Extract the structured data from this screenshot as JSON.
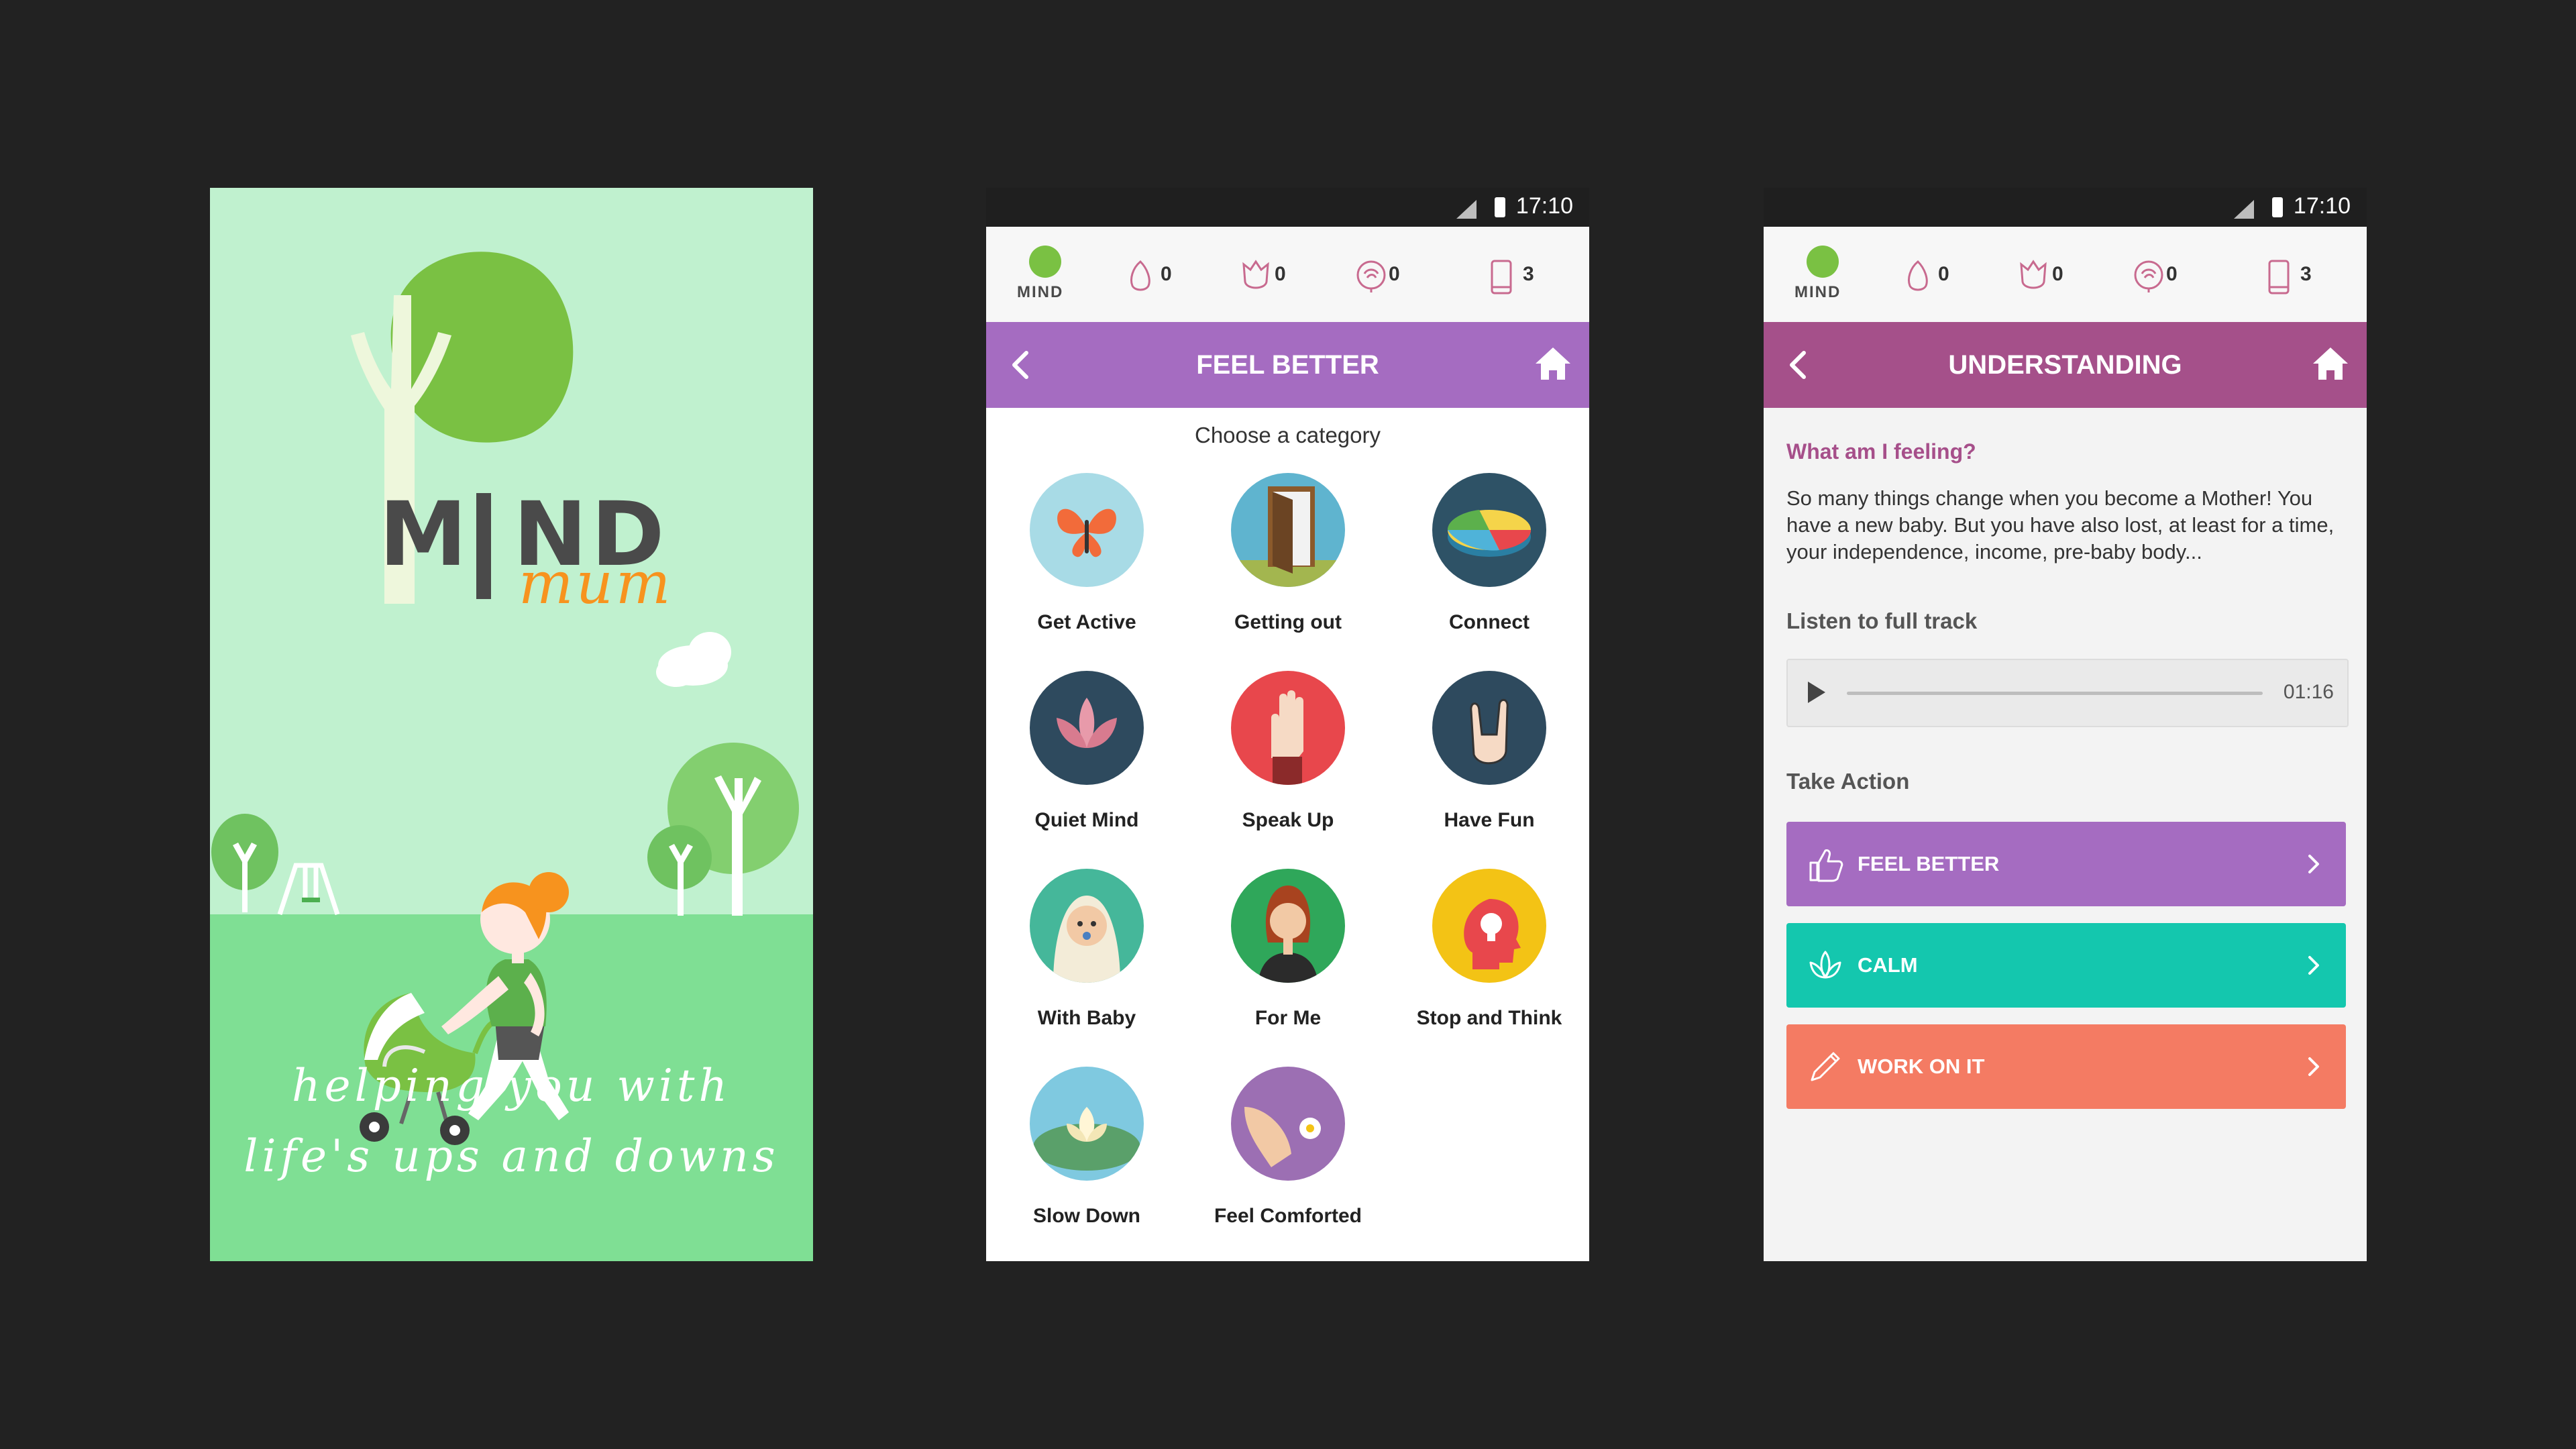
{
  "splash": {
    "logo_letters": [
      "M",
      "N",
      "D"
    ],
    "logo_sub": "mum",
    "tagline_line1": "helping you with",
    "tagline_line2": "life's ups and downs"
  },
  "status": {
    "time": "17:10"
  },
  "appbar": {
    "logo_text": "MIND",
    "counters": [
      {
        "icon": "bud-icon",
        "value": "0"
      },
      {
        "icon": "tulip-icon",
        "value": "0"
      },
      {
        "icon": "rose-icon",
        "value": "0"
      },
      {
        "icon": "phone-icon",
        "value": "3"
      }
    ]
  },
  "feel_better": {
    "title": "FEEL BETTER",
    "accent": "#a56cc1",
    "subtitle": "Choose a category",
    "categories": [
      {
        "label": "Get Active",
        "icon": "butterfly-icon",
        "bg": "#a8dbe6"
      },
      {
        "label": "Getting out",
        "icon": "open-door-icon",
        "bg": "#5fb4cf"
      },
      {
        "label": "Connect",
        "icon": "connect-icon",
        "bg": "#2e5266"
      },
      {
        "label": "Quiet Mind",
        "icon": "lotus-icon",
        "bg": "#2e4a5e"
      },
      {
        "label": "Speak Up",
        "icon": "raised-hand-icon",
        "bg": "#e8474c"
      },
      {
        "label": "Have Fun",
        "icon": "rock-hand-icon",
        "bg": "#2e4a5e"
      },
      {
        "label": "With Baby",
        "icon": "baby-icon",
        "bg": "#45b79a"
      },
      {
        "label": "For Me",
        "icon": "woman-icon",
        "bg": "#2fa75a"
      },
      {
        "label": "Stop and Think",
        "icon": "head-lightbulb-icon",
        "bg": "#f3c315"
      },
      {
        "label": "Slow Down",
        "icon": "water-lily-icon",
        "bg": "#7fc9e0"
      },
      {
        "label": "Feel Comforted",
        "icon": "comfort-hands-icon",
        "bg": "#9c6fb3"
      }
    ]
  },
  "understanding": {
    "title": "UNDERSTANDING",
    "accent": "#a5508a",
    "question": "What am I feeling?",
    "body": "So many things change when you become a Mother! You have a new baby. But you have also lost, at least for a time, your independence, income, pre-baby body...",
    "listen_label": "Listen to full track",
    "track_time": "01:16",
    "take_action_label": "Take Action",
    "actions": [
      {
        "label": "FEEL BETTER",
        "icon": "thumbs-up-icon",
        "color": "#a56cc1"
      },
      {
        "label": "CALM",
        "icon": "lotus-outline-icon",
        "color": "#14c7ae"
      },
      {
        "label": "WORK ON IT",
        "icon": "pencil-icon",
        "color": "#f47b63"
      }
    ]
  }
}
